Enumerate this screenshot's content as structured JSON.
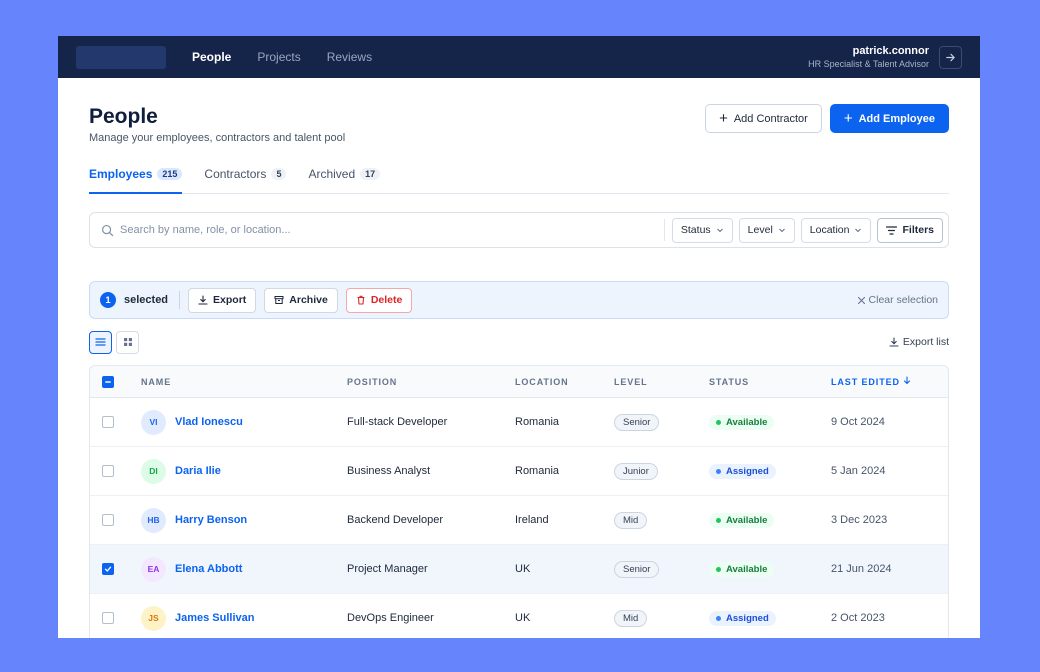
{
  "nav": {
    "items": [
      {
        "label": "People",
        "active": true
      },
      {
        "label": "Projects",
        "active": false
      },
      {
        "label": "Reviews",
        "active": false
      }
    ]
  },
  "user": {
    "name": "patrick.connor",
    "role": "HR Specialist & Talent Advisor",
    "logout_icon": "arrow-right-icon"
  },
  "header": {
    "title": "People",
    "subtitle": "Manage your employees, contractors and talent pool",
    "add_contractor": "Add Contractor",
    "add_employee": "Add Employee"
  },
  "tabs": [
    {
      "label": "Employees",
      "count": "215",
      "active": true
    },
    {
      "label": "Contractors",
      "count": "5",
      "active": false
    },
    {
      "label": "Archived",
      "count": "17",
      "active": false
    }
  ],
  "search": {
    "placeholder": "Search by name, role, or location...",
    "value": ""
  },
  "filters": {
    "status": "Status",
    "level": "Level",
    "location": "Location",
    "filters_btn": "Filters"
  },
  "selection": {
    "count": "1",
    "label": "selected",
    "export": "Export",
    "archive": "Archive",
    "delete": "Delete",
    "clear": "Clear selection"
  },
  "view": {
    "export_list": "Export list",
    "mode": "list"
  },
  "table": {
    "headers": {
      "name": "NAME",
      "position": "POSITION",
      "location": "LOCATION",
      "level": "LEVEL",
      "status": "STATUS",
      "last_edited": "LAST EDITED"
    },
    "rows": [
      {
        "initials": "VI",
        "name": "Vlad Ionescu",
        "position": "Full-stack Developer",
        "location": "Romania",
        "level": "Senior",
        "status": "Available",
        "last_edited": "9 Oct 2024",
        "checked": false,
        "avatar_bg": "#e0ecfd",
        "avatar_fg": "#2563eb"
      },
      {
        "initials": "DI",
        "name": "Daria Ilie",
        "position": "Business Analyst",
        "location": "Romania",
        "level": "Junior",
        "status": "Assigned",
        "last_edited": "5 Jan 2024",
        "checked": false,
        "avatar_bg": "#dcfce7",
        "avatar_fg": "#16a34a"
      },
      {
        "initials": "HB",
        "name": "Harry Benson",
        "position": "Backend Developer",
        "location": "Ireland",
        "level": "Mid",
        "status": "Available",
        "last_edited": "3 Dec 2023",
        "checked": false,
        "avatar_bg": "#e0ecfd",
        "avatar_fg": "#2563eb"
      },
      {
        "initials": "EA",
        "name": "Elena Abbott",
        "position": "Project Manager",
        "location": "UK",
        "level": "Senior",
        "status": "Available",
        "last_edited": "21 Jun 2024",
        "checked": true,
        "avatar_bg": "#f3e8ff",
        "avatar_fg": "#9333ea"
      },
      {
        "initials": "JS",
        "name": "James Sullivan",
        "position": "DevOps Engineer",
        "location": "UK",
        "level": "Mid",
        "status": "Assigned",
        "last_edited": "2 Oct 2023",
        "checked": false,
        "avatar_bg": "#fef3c7",
        "avatar_fg": "#d97706"
      }
    ]
  },
  "colors": {
    "accent": "#0b63f0",
    "topbar": "#15254a",
    "background": "#6684fb",
    "available_bg": "#ecfdf3",
    "available_fg": "#15803d",
    "available_dot": "#22c55e",
    "assigned_bg": "#eaf2fe",
    "assigned_fg": "#1d4ed8",
    "assigned_dot": "#3b82f6",
    "danger": "#dc2626"
  }
}
